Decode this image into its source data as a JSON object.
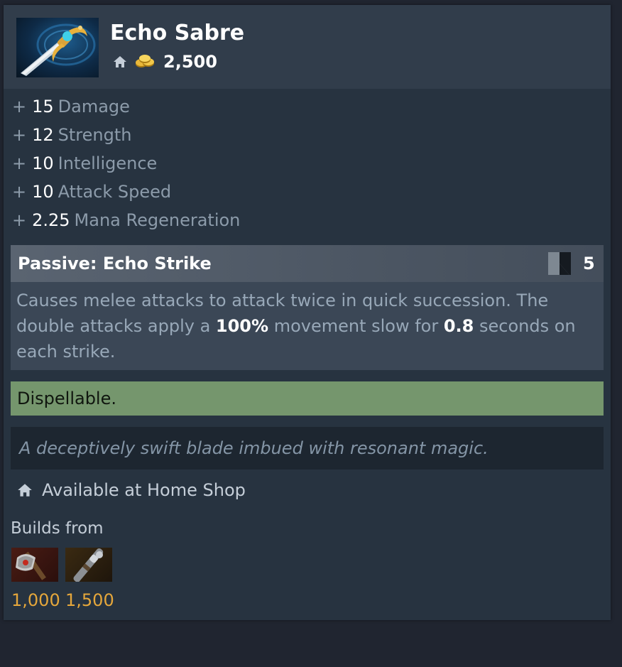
{
  "item": {
    "name": "Echo Sabre",
    "cost": "2,500",
    "image_icon": "echo-sabre-icon"
  },
  "stats": [
    {
      "plus": "+",
      "value": "15",
      "label": "Damage"
    },
    {
      "plus": "+",
      "value": "12",
      "label": "Strength"
    },
    {
      "plus": "+",
      "value": "10",
      "label": "Intelligence"
    },
    {
      "plus": "+",
      "value": "10",
      "label": "Attack Speed"
    },
    {
      "plus": "+",
      "value": "2.25",
      "label": "Mana Regeneration"
    }
  ],
  "ability": {
    "title": "Passive: Echo Strike",
    "cooldown": "5",
    "desc_part1": "Causes melee attacks to attack twice in quick succession. The double attacks apply a ",
    "desc_value1": "100%",
    "desc_part2": " movement slow for ",
    "desc_value2": "0.8",
    "desc_part3": " seconds on each strike."
  },
  "dispel_text": "Dispellable.",
  "lore_text": "A deceptively swift blade imbued with resonant magic.",
  "shop_text": "Available at Home Shop",
  "builds": {
    "label": "Builds from",
    "components": [
      {
        "icon": "ogre-axe-icon",
        "price": "1,000"
      },
      {
        "icon": "oblivion-staff-icon",
        "price": "1,500"
      }
    ]
  },
  "colors": {
    "background": "#202530",
    "panel": "#273340",
    "header": "#313d4b",
    "dispel": "#75966d",
    "price": "#e5a73b"
  }
}
